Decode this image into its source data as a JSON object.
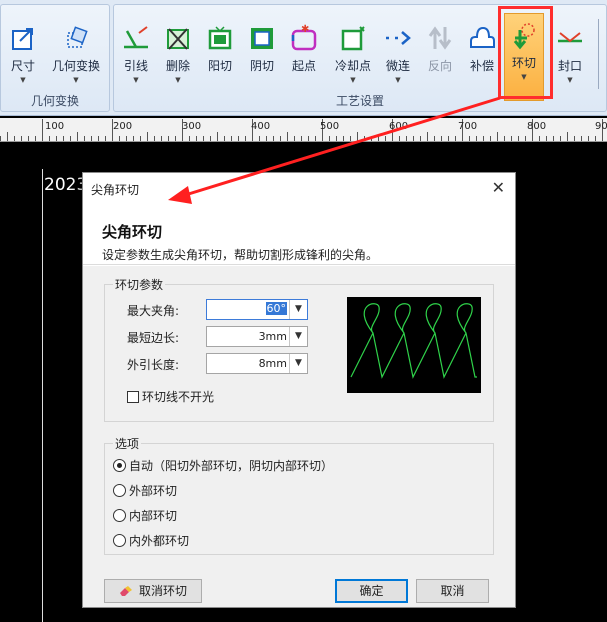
{
  "ribbon": {
    "groups": [
      {
        "label": "几何变换"
      },
      {
        "label": "工艺设置"
      }
    ],
    "buttons": [
      {
        "label": "尺寸",
        "icon": "resize-icon"
      },
      {
        "label": "几何变换",
        "icon": "transform-icon"
      },
      {
        "label": "引线",
        "icon": "lead-line-icon"
      },
      {
        "label": "删除",
        "icon": "delete-icon"
      },
      {
        "label": "阳切",
        "icon": "outer-cut-icon"
      },
      {
        "label": "阴切",
        "icon": "inner-cut-icon"
      },
      {
        "label": "起点",
        "icon": "start-point-icon"
      },
      {
        "label": "冷却点",
        "icon": "cooling-point-icon"
      },
      {
        "label": "微连",
        "icon": "micro-joint-icon"
      },
      {
        "label": "反向",
        "icon": "reverse-icon"
      },
      {
        "label": "补偿",
        "icon": "compensation-icon"
      },
      {
        "label": "环切",
        "icon": "loop-cut-icon"
      },
      {
        "label": "封口",
        "icon": "seal-icon"
      }
    ],
    "colors": {
      "accent": "#fbb040",
      "highlight": "#ff2d2d",
      "icon_green": "#1f9b3a",
      "icon_blue": "#1b63c6"
    }
  },
  "ruler": {
    "ticks": [
      "100",
      "200",
      "300",
      "400",
      "500",
      "600",
      "700",
      "800",
      "900"
    ]
  },
  "canvas": {
    "text": "2023"
  },
  "dialog": {
    "title": "尖角环切",
    "heading": "尖角环切",
    "description": "设定参数生成尖角环切，帮助切割形成锋利的尖角。",
    "params_group": "环切参数",
    "params": [
      {
        "label": "最大夹角:",
        "value": "60°"
      },
      {
        "label": "最短边长:",
        "value": "3mm"
      },
      {
        "label": "外引长度:",
        "value": "8mm"
      }
    ],
    "checkbox_label": "环切线不开光",
    "options_group": "选项",
    "options": [
      {
        "label": "自动（阳切外部环切，阴切内部环切）",
        "selected": true
      },
      {
        "label": "外部环切",
        "selected": false
      },
      {
        "label": "内部环切",
        "selected": false
      },
      {
        "label": "内外都环切",
        "selected": false
      }
    ],
    "buttons": {
      "cancel_loop": "取消环切",
      "ok": "确定",
      "cancel": "取消"
    },
    "close_glyph": "✕",
    "preview_color": "#2fd34a"
  }
}
